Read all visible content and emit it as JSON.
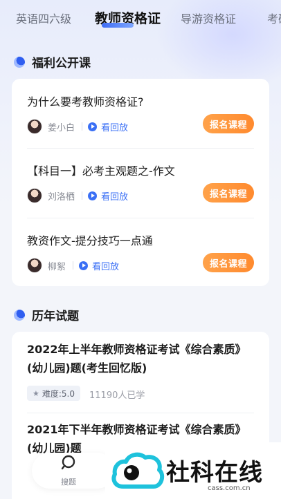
{
  "tabs": {
    "items": [
      "英语四六级",
      "教师资格证",
      "导游资格证",
      "考研"
    ],
    "active": 1
  },
  "sections": {
    "welfare": {
      "title": "福利公开课"
    },
    "exams": {
      "title": "历年试题"
    }
  },
  "courses": [
    {
      "title": "为什么要考教师资格证?",
      "teacher": "姜小白",
      "replay": "看回放",
      "signup": "报名课程"
    },
    {
      "title": "【科目一】必考主观题之-作文",
      "teacher": "刘洛栖",
      "replay": "看回放",
      "signup": "报名课程"
    },
    {
      "title": "教资作文-提分技巧一点通",
      "teacher": "柳絮",
      "replay": "看回放",
      "signup": "报名课程"
    }
  ],
  "exams": [
    {
      "title": "2022年上半年教师资格证考试《综合素质》(幼儿园)题(考生回忆版)",
      "difficulty": "难度:5.0",
      "learners": "11190人已学"
    },
    {
      "title": "2021年下半年教师资格证考试《综合素质》(幼儿园)题"
    }
  ],
  "bottom_nav": {
    "search_label": "搜题"
  },
  "watermark": {
    "text": "社科在线",
    "url": "cass.com.cn"
  },
  "colors": {
    "accent": "#3a6ff5",
    "signup": "#ff8a2e"
  }
}
